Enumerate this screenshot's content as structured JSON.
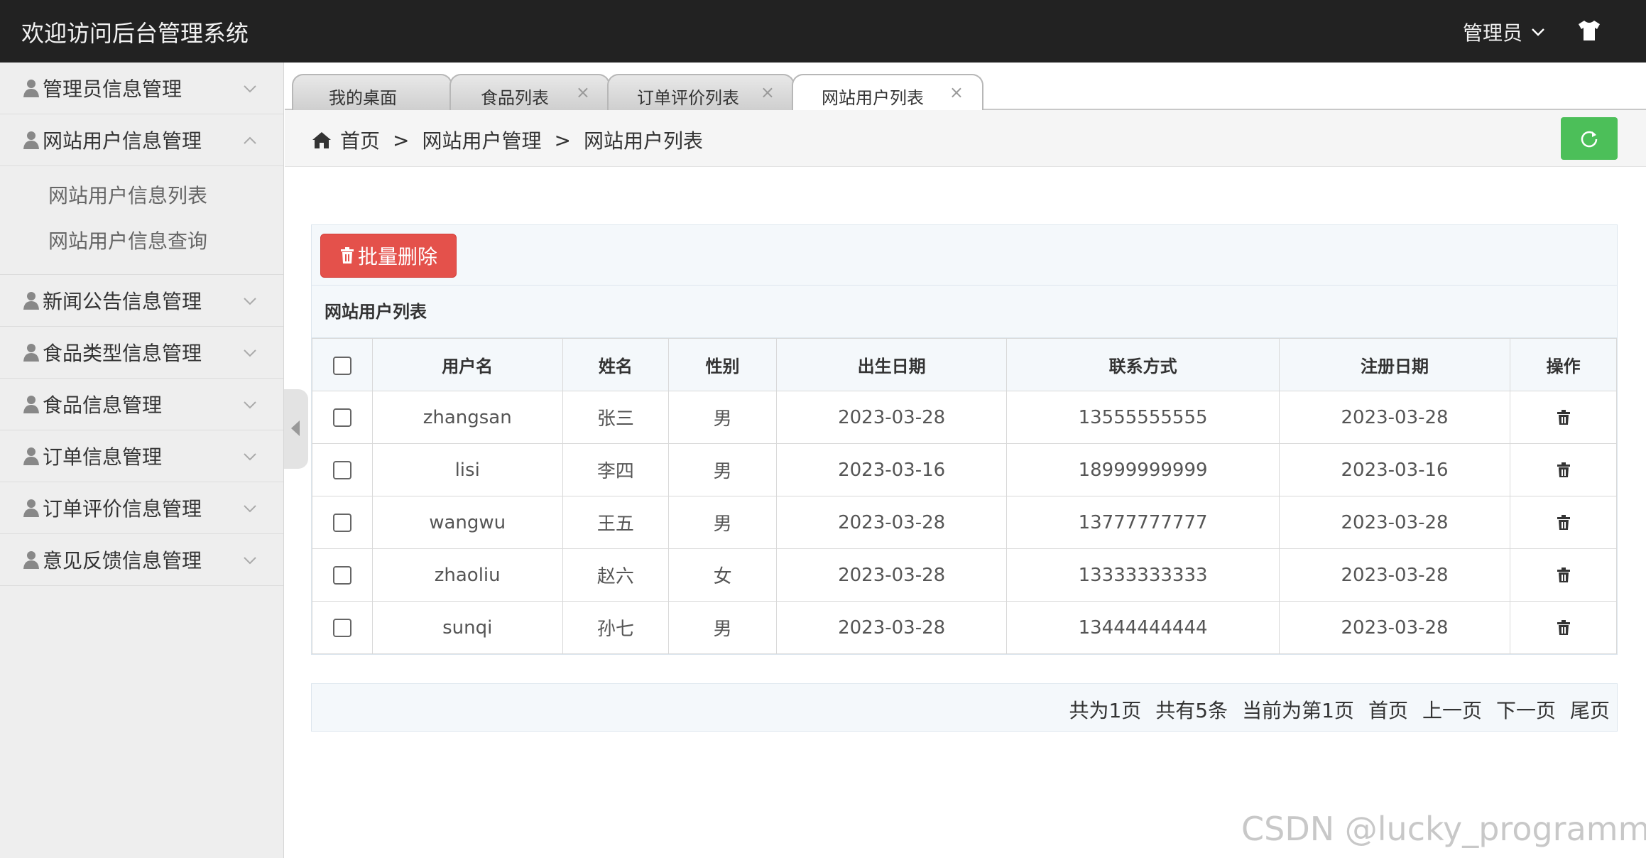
{
  "header": {
    "title": "欢迎访问后台管理系统",
    "user": "管理员"
  },
  "sidebar": {
    "menus": [
      {
        "label": "管理员信息管理"
      },
      {
        "label": "网站用户信息管理",
        "expanded": true,
        "children": [
          "网站用户信息列表",
          "网站用户信息查询"
        ]
      },
      {
        "label": "新闻公告信息管理"
      },
      {
        "label": "食品类型信息管理"
      },
      {
        "label": "食品信息管理"
      },
      {
        "label": "订单信息管理"
      },
      {
        "label": "订单评价信息管理"
      },
      {
        "label": "意见反馈信息管理"
      }
    ]
  },
  "tabs": [
    {
      "label": "我的桌面"
    },
    {
      "label": "食品列表",
      "close": "×"
    },
    {
      "label": "订单评价列表",
      "close": "×"
    },
    {
      "label": "网站用户列表",
      "close": "×",
      "active": true
    }
  ],
  "breadcrumb": {
    "home": "首页",
    "sep": ">",
    "level1": "网站用户管理",
    "level2": "网站用户列表"
  },
  "toolbar": {
    "batch_delete": "批量删除"
  },
  "table": {
    "title": "网站用户列表",
    "columns": [
      "用户名",
      "姓名",
      "性别",
      "出生日期",
      "联系方式",
      "注册日期",
      "操作"
    ],
    "rows": [
      [
        "zhangsan",
        "张三",
        "男",
        "2023-03-28",
        "13555555555",
        "2023-03-28"
      ],
      [
        "lisi",
        "李四",
        "男",
        "2023-03-16",
        "18999999999",
        "2023-03-16"
      ],
      [
        "wangwu",
        "王五",
        "男",
        "2023-03-28",
        "13777777777",
        "2023-03-28"
      ],
      [
        "zhaoliu",
        "赵六",
        "女",
        "2023-03-28",
        "13333333333",
        "2023-03-28"
      ],
      [
        "sunqi",
        "孙七",
        "男",
        "2023-03-28",
        "13444444444",
        "2023-03-28"
      ]
    ]
  },
  "pagination": {
    "total_pages": "共为1页",
    "total_items": "共有5条",
    "current": "当前为第1页",
    "first": "首页",
    "prev": "上一页",
    "next": "下一页",
    "last": "尾页"
  },
  "watermark": "CSDN @lucky_programmer",
  "colors": {
    "topbar": "#222222",
    "danger": "#e4514b",
    "success": "#4cbf59"
  }
}
